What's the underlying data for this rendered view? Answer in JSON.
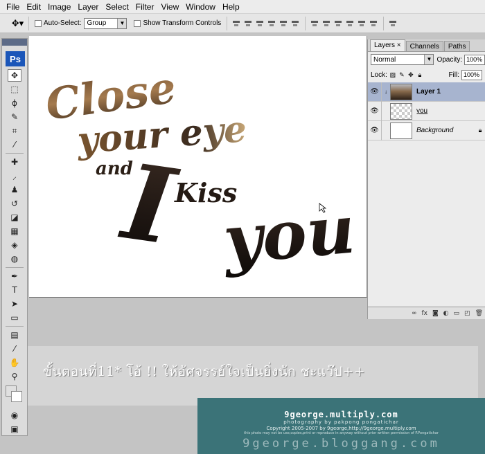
{
  "menu": [
    "File",
    "Edit",
    "Image",
    "Layer",
    "Select",
    "Filter",
    "View",
    "Window",
    "Help"
  ],
  "options": {
    "auto_select_label": "Auto-Select:",
    "auto_select_value": "Group",
    "show_transform_label": "Show Transform Controls"
  },
  "tools": {
    "logo": "Ps"
  },
  "canvas": {
    "artwork_words": [
      "Close",
      "your eye",
      "and",
      "I",
      "Kiss",
      "you"
    ]
  },
  "layers_panel": {
    "tabs": [
      {
        "label": "Layers ×"
      },
      {
        "label": "Channels"
      },
      {
        "label": "Paths"
      }
    ],
    "blend_mode": "Normal",
    "opacity_label": "Opacity:",
    "opacity_value": "100%",
    "lock_label": "Lock:",
    "fill_label": "Fill:",
    "fill_value": "100%",
    "layers": [
      {
        "name": "Layer 1"
      },
      {
        "name": "you"
      },
      {
        "name": "Background"
      }
    ]
  },
  "caption": "ขั้นตอนที่11* โอ้ !! ให้อัศจรรย์ใจเป็นยิ่งนัก ชะแว๊ป++",
  "watermark": {
    "main": "9george.multiply.com",
    "line1": "photography by pakpong pongatichar",
    "line2": "Copyright 2005-2007 by 9george,http://9george.multiply.com",
    "line3": "this photo may not be use,copies,print or reproduce in anyway without prior written permission of P.Pongatichar",
    "big": "9george.bloggang.com"
  },
  "colors": {
    "watermark_bg": "#3b7378",
    "selected_layer": "#a7b4cf",
    "ps_logo": "#1b56b9"
  }
}
